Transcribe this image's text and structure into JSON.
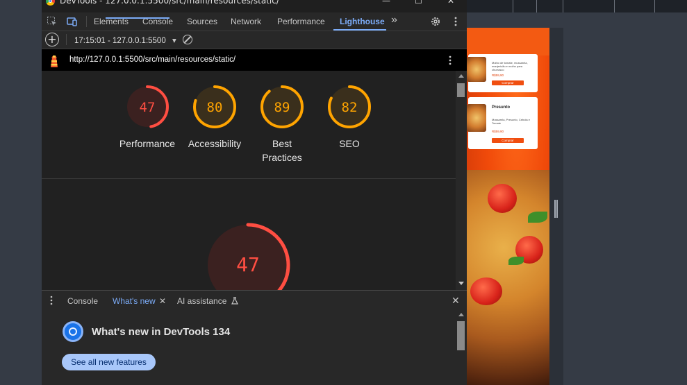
{
  "window": {
    "title": "DevTools - 127.0.0.1:5500/src/main/resources/static/",
    "minimize_glyph": "—",
    "maximize_glyph": "☐",
    "close_glyph": "✕"
  },
  "main_tabs": [
    {
      "label": "Elements"
    },
    {
      "label": "Console"
    },
    {
      "label": "Sources"
    },
    {
      "label": "Network"
    },
    {
      "label": "Performance"
    },
    {
      "label": "Lighthouse",
      "active": true
    }
  ],
  "more_tabs_glyph": "»",
  "toolbar": {
    "run_label": "17:15:01 - 127.0.0.1:5500",
    "dropdown_glyph": "▾"
  },
  "report_url": "http://127.0.0.1:5500/src/main/resources/static/",
  "scores": [
    {
      "label_line1": "Performance",
      "label_line2": "",
      "value": "47",
      "score": 47,
      "color": "#ff4e42",
      "track": "#3b2120",
      "text_color": "#ff4e42"
    },
    {
      "label_line1": "Accessibility",
      "label_line2": "",
      "value": "80",
      "score": 80,
      "color": "#ffa400",
      "track": "#3a2f1c",
      "text_color": "#ffa400"
    },
    {
      "label_line1": "Best",
      "label_line2": "Practices",
      "value": "89",
      "score": 89,
      "color": "#ffa400",
      "track": "#3a2f1c",
      "text_color": "#ffa400"
    },
    {
      "label_line1": "SEO",
      "label_line2": "",
      "value": "82",
      "score": 82,
      "color": "#ffa400",
      "track": "#3a2f1c",
      "text_color": "#ffa400"
    }
  ],
  "big_gauge": {
    "value": "47",
    "score": 47,
    "color": "#ff4e42",
    "track": "#3b2120"
  },
  "drawer_tabs": [
    {
      "label": "Console"
    },
    {
      "label": "What's new",
      "active": true,
      "closable": true
    },
    {
      "label": "AI assistance",
      "flask": true
    }
  ],
  "drawer": {
    "heading": "What's new in DevTools 134",
    "button_label": "See all new features",
    "close_glyph": "✕",
    "tab_close_glyph": "✕"
  },
  "preview": {
    "cards": [
      {
        "name": "",
        "desc": "Molho de tomate, mussarela, manjericão e molho para churrasco",
        "price": "R$59,90",
        "buy": "Comprar"
      },
      {
        "name": "Presunto",
        "desc": "Mussarela, Presunto, Cebola e Tomate",
        "price": "R$59,90",
        "buy": "Comprar"
      }
    ]
  }
}
